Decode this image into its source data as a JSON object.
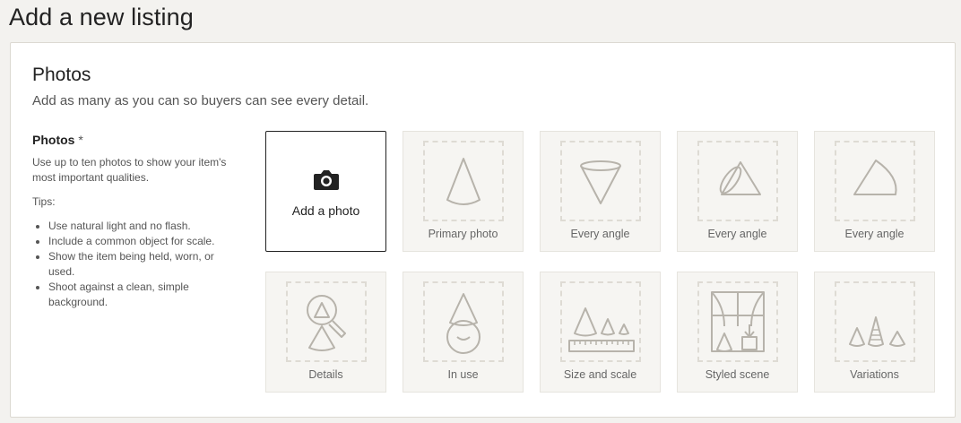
{
  "page": {
    "title": "Add a new listing"
  },
  "photos_section": {
    "title": "Photos",
    "subtitle": "Add as many as you can so buyers can see every detail.",
    "field_label": "Photos",
    "required_marker": "*",
    "description": "Use up to ten photos to show your item's most important qualities.",
    "tips_label": "Tips:",
    "tips": [
      "Use natural light and no flash.",
      "Include a common object for scale.",
      "Show the item being held, worn, or used.",
      "Shoot against a clean, simple background."
    ],
    "add_photo": {
      "label": "Add a photo",
      "icon": "camera-icon"
    },
    "slots": [
      {
        "label": "Primary photo",
        "icon": "cone-upright-icon"
      },
      {
        "label": "Every angle",
        "icon": "cone-inverted-icon"
      },
      {
        "label": "Every angle",
        "icon": "cone-tilted-icon"
      },
      {
        "label": "Every angle",
        "icon": "cone-side-icon"
      },
      {
        "label": "Details",
        "icon": "magnifier-cone-icon"
      },
      {
        "label": "In use",
        "icon": "cone-hat-person-icon"
      },
      {
        "label": "Size and scale",
        "icon": "cones-ruler-icon"
      },
      {
        "label": "Styled scene",
        "icon": "window-scene-icon"
      },
      {
        "label": "Variations",
        "icon": "cone-variations-icon"
      }
    ]
  },
  "colors": {
    "background": "#f3f2ef",
    "card": "#ffffff",
    "tile": "#f6f5f2",
    "illustration_stroke": "#b7b3ab",
    "add_border": "#222222"
  }
}
